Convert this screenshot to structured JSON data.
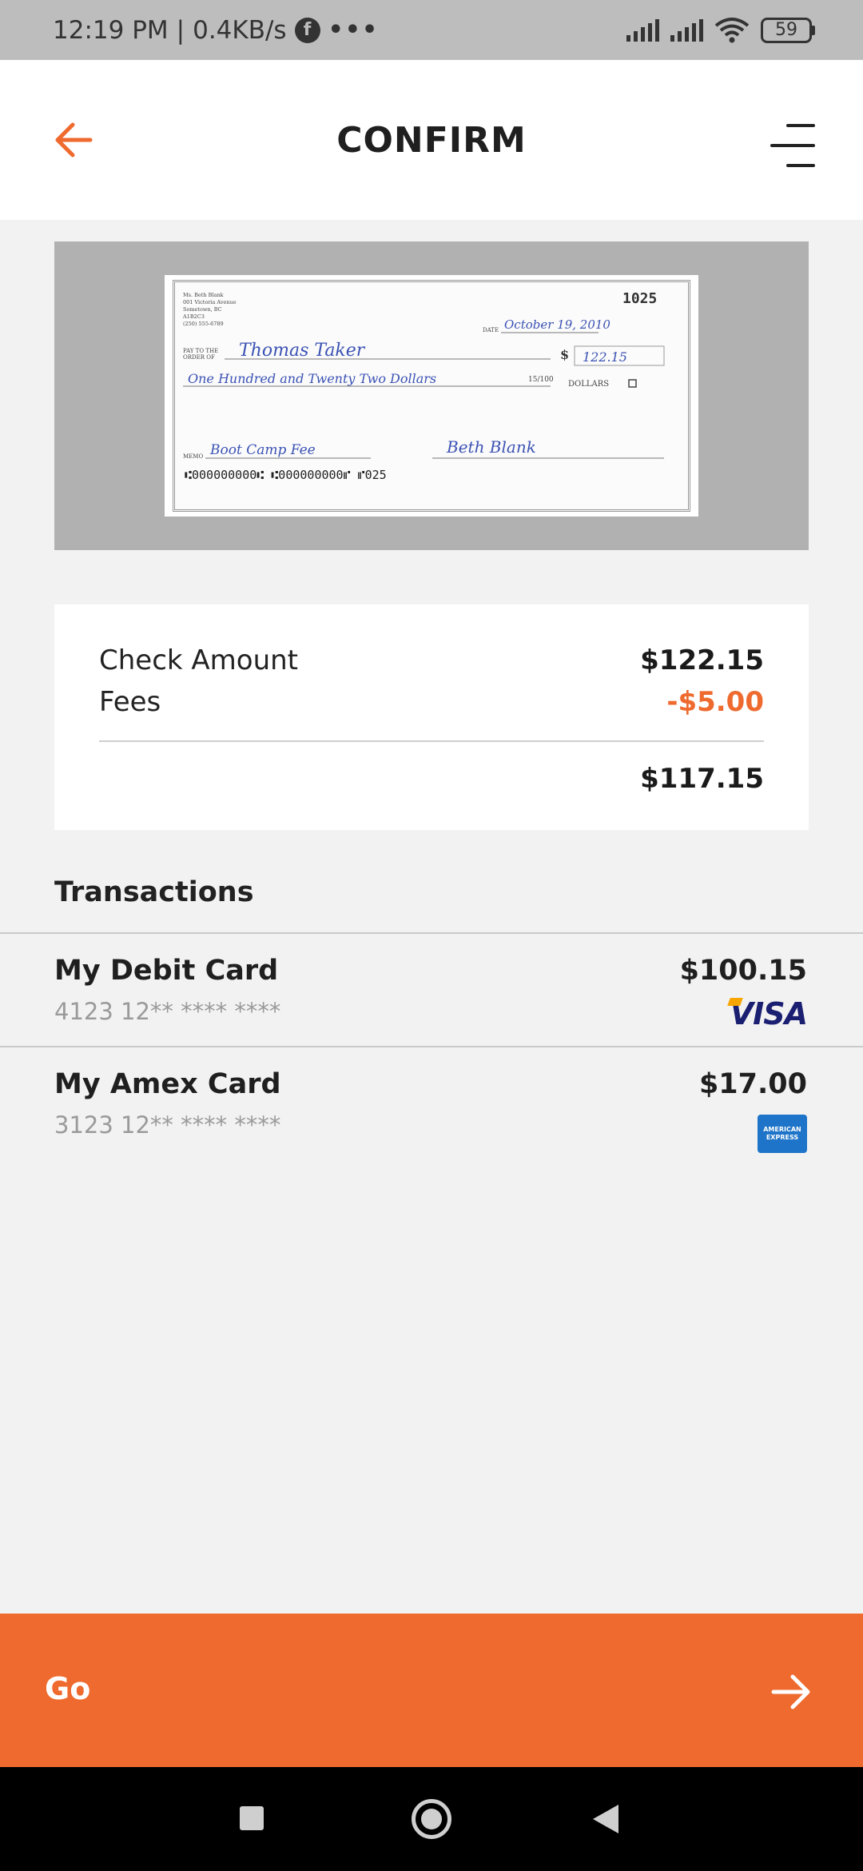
{
  "status_bar": {
    "time": "12:19 PM",
    "separator": "|",
    "network_speed": "0.4KB/s",
    "notification_icon_letter": "f",
    "overflow": "•••",
    "battery_level": "59"
  },
  "header": {
    "title": "CONFIRM",
    "back_icon": "arrow-left-icon",
    "menu_icon": "menu-icon"
  },
  "check": {
    "payer_lines": [
      "Ms. Beth Blank",
      "001 Victoria Avenue",
      "Sometown, BC",
      "A1B2C3",
      "(250) 555-6789"
    ],
    "check_number": "1025",
    "date_label": "DATE",
    "date": "October 19, 2010",
    "pay_to_label_1": "PAY TO THE",
    "pay_to_label_2": "ORDER OF",
    "payee": "Thomas Taker",
    "dollar_sign": "$",
    "amount_numeric": "122.15",
    "amount_words": "One Hundred and Twenty Two Dollars",
    "cents": "15/100",
    "dollars_label": "DOLLARS",
    "memo_label": "MEMO",
    "memo": "Boot Camp Fee",
    "signature": "Beth Blank",
    "micr": "⑆000000000⑆  ⑆000000000⑈  ⑈025"
  },
  "summary": {
    "check_amount_label": "Check Amount",
    "check_amount": "$122.15",
    "fees_label": "Fees",
    "fees": "-$5.00",
    "total": "$117.15"
  },
  "transactions": {
    "heading": "Transactions",
    "items": [
      {
        "name": "My Debit Card",
        "number": "4123 12** **** ****",
        "amount": "$100.15",
        "brand": "VISA"
      },
      {
        "name": "My Amex Card",
        "number": "3123 12** **** ****",
        "amount": "$17.00",
        "brand_line1": "AMERICAN",
        "brand_line2": "EXPRESS"
      }
    ]
  },
  "action": {
    "go_label": "Go",
    "arrow_icon": "arrow-right-icon"
  },
  "colors": {
    "accent": "#ef6a2e",
    "status_bar": "#bdbdbd",
    "check_background": "#b1b1b1",
    "handwriting": "#3b52b4",
    "visa_blue": "#1a1f71",
    "amex_blue": "#1e74c8"
  }
}
